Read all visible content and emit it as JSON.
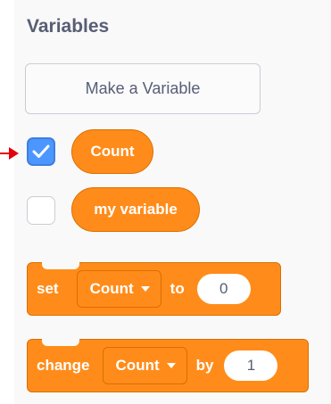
{
  "category": {
    "title": "Variables"
  },
  "make_variable_button": {
    "label": "Make a Variable"
  },
  "variables": [
    {
      "name": "Count",
      "checked": true
    },
    {
      "name": "my variable",
      "checked": false
    }
  ],
  "set_block": {
    "keyword": "set",
    "variable": "Count",
    "preposition": "to",
    "value": "0"
  },
  "change_block": {
    "keyword": "change",
    "variable": "Count",
    "preposition": "by",
    "value": "1"
  },
  "colors": {
    "variables_orange": "#ff8c1a",
    "checkbox_blue": "#4c97ff",
    "pointer_arrow_red": "#e3000b",
    "label_gray": "#575e75"
  },
  "icons": {
    "pointer": "arrow-right-icon",
    "check": "checkmark-icon",
    "dropdown": "caret-down-icon"
  }
}
